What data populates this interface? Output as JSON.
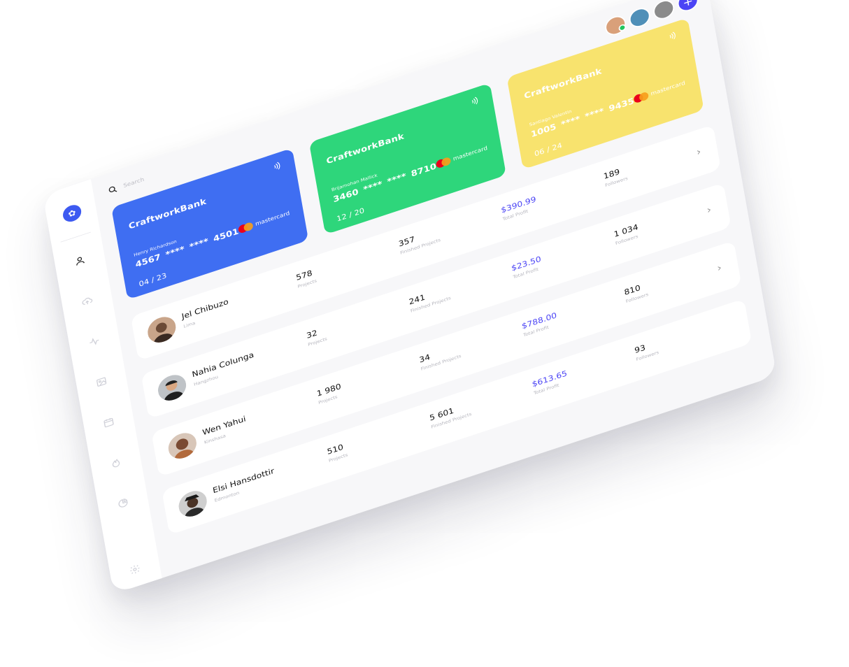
{
  "search": {
    "placeholder": "Search"
  },
  "sidebar": {
    "logo_icon": "leaf-icon",
    "items": [
      {
        "icon": "user-icon",
        "active": true
      },
      {
        "icon": "cloud-upload-icon",
        "active": false
      },
      {
        "icon": "activity-icon",
        "active": false
      },
      {
        "icon": "image-icon",
        "active": false
      },
      {
        "icon": "calendar-icon",
        "active": false
      },
      {
        "icon": "flame-icon",
        "active": false
      },
      {
        "icon": "pie-chart-icon",
        "active": false
      }
    ],
    "settings_icon": "gear-icon"
  },
  "topbar": {
    "avatars": [
      {
        "color": "#d9a07a",
        "online": true
      },
      {
        "color": "#4f8fb8",
        "online": false
      },
      {
        "color": "#8b8b8b",
        "online": false
      }
    ],
    "add_label": "+"
  },
  "cards": [
    {
      "bank": "CraftworkBank",
      "holder": "Henry Richardson",
      "number": "4567 **** **** 4501",
      "expiry": "04 / 23",
      "brand": "mastercard",
      "color": "#3f6ef2"
    },
    {
      "bank": "CraftworkBank",
      "holder": "Brijamohan Mallick",
      "number": "3460 **** **** 8710",
      "expiry": "12 / 20",
      "brand": "mastercard",
      "color": "#2ed67b"
    },
    {
      "bank": "CraftworkBank",
      "holder": "Santiago Valentin",
      "number": "1005 **** **** 9435",
      "expiry": "06 / 24",
      "brand": "mastercard",
      "color": "#f8e36e"
    }
  ],
  "rows": [
    {
      "name": "Jel Chibuzo",
      "city": "Lima",
      "projects": "578",
      "projects_label": "Projects",
      "finished": "357",
      "finished_label": "Finished Projects",
      "profit": "$390.99",
      "profit_label": "Total Profit",
      "followers": "189",
      "followers_label": "Followers"
    },
    {
      "name": "Nahia Colunga",
      "city": "Hangzhou",
      "projects": "32",
      "projects_label": "Projects",
      "finished": "241",
      "finished_label": "Finished Projects",
      "profit": "$23.50",
      "profit_label": "Total Profit",
      "followers": "1 034",
      "followers_label": "Followers"
    },
    {
      "name": "Wen Yahui",
      "city": "Kinshasa",
      "projects": "1 980",
      "projects_label": "Projects",
      "finished": "34",
      "finished_label": "Finished Projects",
      "profit": "$788.00",
      "profit_label": "Total Profit",
      "followers": "810",
      "followers_label": "Followers"
    },
    {
      "name": "Elsi Hansdottir",
      "city": "Edmonton",
      "projects": "510",
      "projects_label": "Projects",
      "finished": "5 601",
      "finished_label": "Finished Projects",
      "profit": "$613.65",
      "profit_label": "Total Profit",
      "followers": "93",
      "followers_label": "Followers"
    }
  ]
}
